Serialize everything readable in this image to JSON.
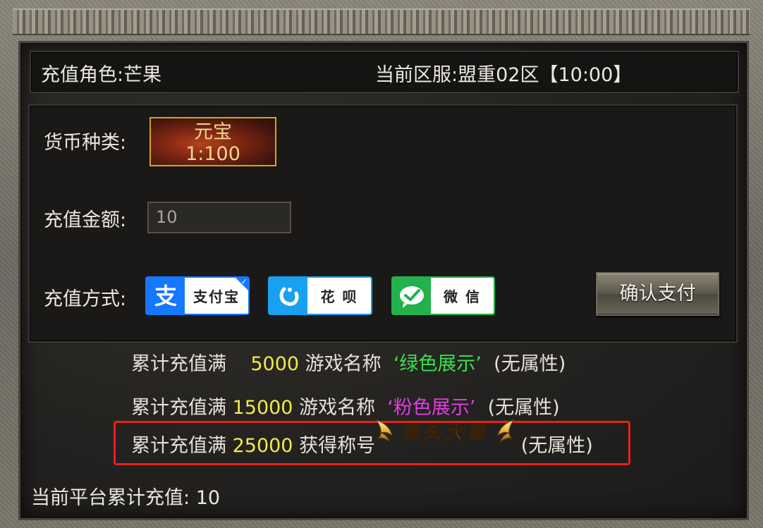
{
  "header": {
    "role_label": "充值角色:",
    "role_value": "芒果",
    "server_label": "当前区服:",
    "server_value": "盟重02区【10:00】"
  },
  "currency": {
    "label": "货币种类:",
    "name": "元宝",
    "ratio": "1:100"
  },
  "amount": {
    "label": "充值金额:",
    "value": "10"
  },
  "payment": {
    "label": "充值方式:",
    "methods": [
      {
        "name": "支付宝",
        "icon": "alipay-icon",
        "color": "#1677ff"
      },
      {
        "name": "花 呗",
        "icon": "huabei-icon",
        "color": "#1aa0f0"
      },
      {
        "name": "微 信",
        "icon": "wechat-icon",
        "color": "#22b14c"
      }
    ],
    "confirm_label": "确认支付"
  },
  "tiers": [
    {
      "prefix": "累计充值满",
      "amount": "5000",
      "middle": "游戏名称",
      "reward": "‘绿色展示’",
      "suffix": "(无属性)",
      "reward_color": "#36e24c"
    },
    {
      "prefix": "累计充值满",
      "amount": "15000",
      "middle": "游戏名称",
      "reward": "‘粉色展示’",
      "suffix": "(无属性)",
      "reward_color": "#e23de2"
    },
    {
      "prefix": "累计充值满",
      "amount": "25000",
      "middle": "获得称号",
      "title_badge": "带头大哥",
      "suffix": "(无属性)"
    }
  ],
  "footer": {
    "label": "当前平台累计充值:",
    "value": "10"
  },
  "colors": {
    "highlight_border": "#e8201c",
    "amount_yellow": "#f2e94c",
    "gold": "#d4a227"
  }
}
